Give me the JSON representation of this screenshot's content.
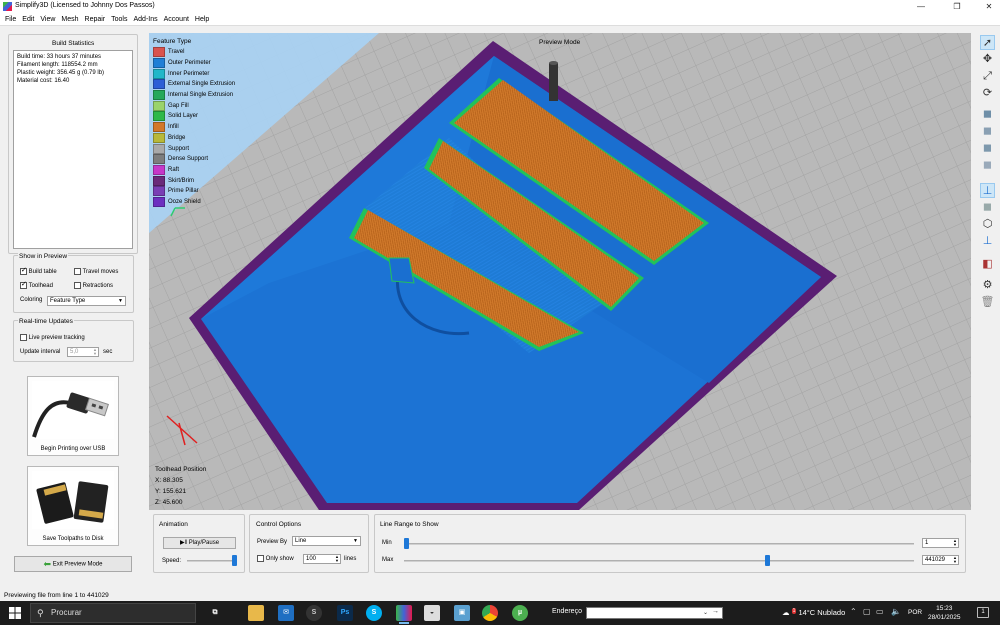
{
  "window": {
    "title": "Simplify3D (Licensed to Johnny Dos Passos)"
  },
  "menu": [
    "File",
    "Edit",
    "View",
    "Mesh",
    "Repair",
    "Tools",
    "Add-Ins",
    "Account",
    "Help"
  ],
  "build_statistics": {
    "title": "Build Statistics",
    "lines": [
      "Build time: 33 hours 37 minutes",
      "Filament length: 118554.2 mm",
      "Plastic weight: 356.45 g (0.79 lb)",
      "Material cost: 16.40"
    ]
  },
  "show_in_preview": {
    "title": "Show in Preview",
    "build_table": {
      "label": "Build table",
      "checked": true
    },
    "travel_moves": {
      "label": "Travel moves",
      "checked": false
    },
    "toolhead": {
      "label": "Toolhead",
      "checked": true
    },
    "retractions": {
      "label": "Retractions",
      "checked": false
    },
    "coloring_label": "Coloring",
    "coloring_value": "Feature Type"
  },
  "realtime": {
    "title": "Real-time Updates",
    "live_label": "Live preview tracking",
    "live_checked": false,
    "interval_label": "Update interval",
    "interval_value": "5,0",
    "interval_unit": "sec"
  },
  "actions": {
    "usb_label": "Begin Printing over USB",
    "disk_label": "Save Toolpaths to Disk",
    "exit_label": "Exit Preview Mode"
  },
  "viewport": {
    "legend_title": "Feature Type",
    "legend": [
      {
        "label": "Travel",
        "color": "#d9534f"
      },
      {
        "label": "Outer Perimeter",
        "color": "#1f7ed6"
      },
      {
        "label": "Inner Perimeter",
        "color": "#22b7c9"
      },
      {
        "label": "External Single Extrusion",
        "color": "#2d5fd6"
      },
      {
        "label": "Internal Single Extrusion",
        "color": "#25a85a"
      },
      {
        "label": "Gap Fill",
        "color": "#9ad36b"
      },
      {
        "label": "Solid Layer",
        "color": "#2eb84a"
      },
      {
        "label": "Infill",
        "color": "#d2782a"
      },
      {
        "label": "Bridge",
        "color": "#b8b83a"
      },
      {
        "label": "Support",
        "color": "#a9a9a9"
      },
      {
        "label": "Dense Support",
        "color": "#7d7d7d"
      },
      {
        "label": "Raft",
        "color": "#c638c9"
      },
      {
        "label": "Skirt/Brim",
        "color": "#6a2a7a"
      },
      {
        "label": "Prime Pillar",
        "color": "#7a3fb5"
      },
      {
        "label": "Ooze Shield",
        "color": "#6d2fc0"
      }
    ],
    "mode_label": "Preview Mode",
    "toolhead_title": "Toolhead Position",
    "toolhead_x": "X: 88.305",
    "toolhead_y": "Y: 155.621",
    "toolhead_z": "Z: 45.600"
  },
  "animation": {
    "title": "Animation",
    "play_label": "Play/Pause",
    "speed_label": "Speed:",
    "speed_fraction": 1.0
  },
  "control_options": {
    "title": "Control Options",
    "preview_by_label": "Preview By",
    "preview_by_value": "Line",
    "only_show_label": "Only show",
    "only_show_checked": false,
    "only_show_value": "100",
    "lines_label": "lines"
  },
  "line_range": {
    "title": "Line Range to Show",
    "min_label": "Min",
    "min_value": "1",
    "max_label": "Max",
    "max_value": "441029",
    "min_fraction": 0.0,
    "max_fraction": 0.715
  },
  "status": {
    "text": "Previewing file from line 1 to 441029"
  },
  "taskbar": {
    "search_placeholder": "Procurar",
    "address_label": "Endereço",
    "weather": "14°C  Nublado",
    "weather_badge": "1",
    "language": "POR",
    "time": "15:23",
    "date": "28/01/2025",
    "notifications": "1",
    "apps": [
      "task-view",
      "file-explorer",
      "mail",
      "steam",
      "photoshop",
      "skype",
      "simplify3d",
      "app-7",
      "app-8",
      "chrome",
      "utorrent"
    ]
  }
}
